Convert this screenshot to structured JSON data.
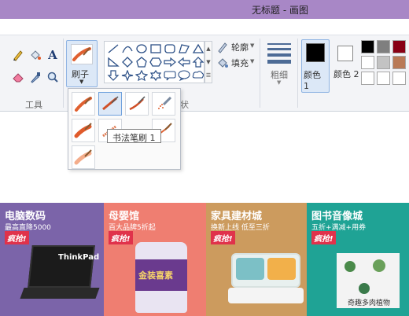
{
  "window": {
    "title": "无标题 - 画图"
  },
  "ribbon": {
    "tools_group_label": "工具",
    "brushes_label": "刷子",
    "shapes_group_label_fragment": "状",
    "outline_label": "轮廓",
    "fill_label": "填充",
    "size_label": "粗细",
    "color1_label": "颜色 1",
    "color2_label": "颜色 2",
    "tools": [
      "pencil-icon",
      "fill-bucket-icon",
      "text-icon",
      "eraser-icon",
      "color-picker-icon",
      "magnifier-icon"
    ],
    "color1": "#000000",
    "color2": "#ffffff",
    "palette": [
      "#000000",
      "#7f7f7f",
      "#880015",
      "#ffffff",
      "#c3c3c3",
      "#b97a57",
      "#ffffff",
      "#ffffff",
      "#ffffff"
    ]
  },
  "brush_menu": {
    "tooltip": "书法笔刷 1",
    "items": [
      "brush",
      "calligraphy-brush-1",
      "calligraphy-brush-2",
      "airbrush",
      "oil-brush",
      "crayon",
      "marker",
      "natural-pencil",
      "watercolor-brush"
    ]
  },
  "banners": [
    {
      "title": "电脑数码",
      "subtitle": "最高直降5000",
      "tag": "疯抢!",
      "bg": "#7b64a9",
      "product_text": "ThinkPad"
    },
    {
      "title": "母婴馆",
      "subtitle": "百大品牌5折起",
      "tag": "疯抢!",
      "bg": "#ef7e71",
      "product_text": "金装喜素"
    },
    {
      "title": "家具建材城",
      "subtitle": "换新上线 低至三折",
      "tag": "疯抢!",
      "bg": "#cc9b5e",
      "product_text": ""
    },
    {
      "title": "图书音像城",
      "subtitle": "五折+满减+用券",
      "tag": "疯抢!",
      "bg": "#1fa395",
      "product_text": "奇趣多肉植物"
    }
  ]
}
